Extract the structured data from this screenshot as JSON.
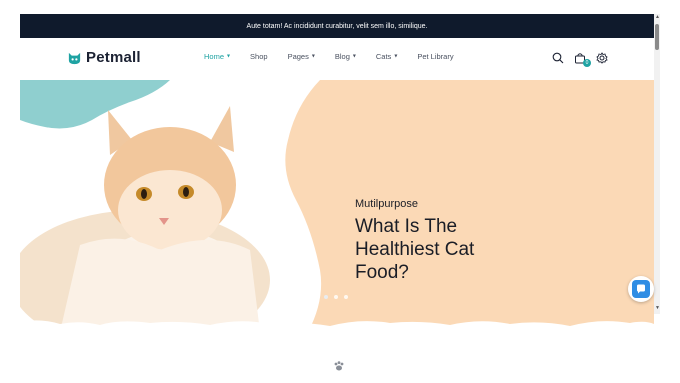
{
  "topbar": {
    "text": "Aute totam! Ac incididunt curabitur, velit sem illo, similique."
  },
  "logo": {
    "text": "Petmall"
  },
  "nav": {
    "items": [
      {
        "label": "Home",
        "has_caret": true
      },
      {
        "label": "Shop",
        "has_caret": false
      },
      {
        "label": "Pages",
        "has_caret": true
      },
      {
        "label": "Blog",
        "has_caret": true
      },
      {
        "label": "Cats",
        "has_caret": true
      },
      {
        "label": "Pet Library",
        "has_caret": false
      }
    ]
  },
  "header_icons": {
    "search": "search-icon",
    "cart": "shopping-bag-icon",
    "cart_count": "0",
    "settings": "gear-icon"
  },
  "hero": {
    "subtitle": "Mutilpurpose",
    "title": "What Is The Healthiest Cat Food?",
    "slides": 3,
    "active_slide": 1
  },
  "colors": {
    "accent": "#1fa3a3",
    "topbar": "#0f1a2c",
    "peach": "#fbd9b6",
    "teal_blob": "#8fcfcf",
    "text_dark": "#1a1d26"
  },
  "footer_icon": "paw-icon"
}
